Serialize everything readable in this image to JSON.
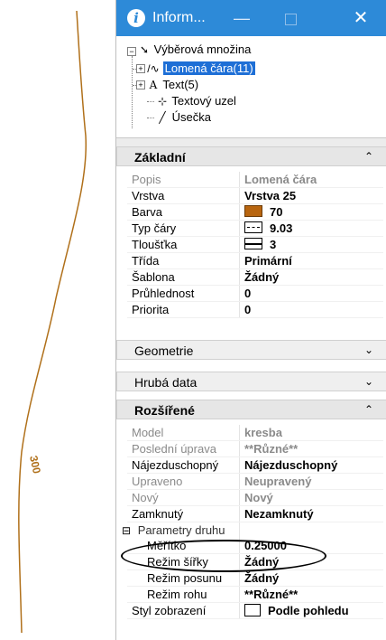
{
  "drawing": {
    "annotation_label": "300",
    "line_color": "#b0701a"
  },
  "window": {
    "title": "Inform...",
    "info_icon": "i",
    "min_glyph": "—",
    "close_glyph": "✕",
    "accent_color": "#2d8ad8"
  },
  "tree": {
    "root_label": "Výběrová množina",
    "items": [
      {
        "icon": "polyline-icon",
        "glyph": "/∿",
        "label": "Lomená čára(11)",
        "selected": true
      },
      {
        "icon": "text-icon",
        "glyph": "A",
        "label": "Text(5)",
        "selected": false
      },
      {
        "icon": "text-node-icon",
        "glyph": "⊹",
        "label": "Textový uzel",
        "selected": false
      },
      {
        "icon": "line-icon",
        "glyph": "╱",
        "label": "Úsečka",
        "selected": false
      }
    ]
  },
  "sections": {
    "basic": {
      "title": "Základní",
      "chevron": "⌃"
    },
    "geometry": {
      "title": "Geometrie",
      "chevron": "⌄"
    },
    "raw": {
      "title": "Hrubá data",
      "chevron": "⌄"
    },
    "extended": {
      "title": "Rozšířené",
      "chevron": "⌃"
    }
  },
  "basic_props": [
    {
      "name": "Popis",
      "value": "Lomená čára",
      "muted": true
    },
    {
      "name": "Vrstva",
      "value": "Vrstva 25"
    },
    {
      "name": "Barva",
      "value": "70",
      "swatch": "#b8650f"
    },
    {
      "name": "Typ čáry",
      "value": "9.03"
    },
    {
      "name": "Tloušťka",
      "value": "3"
    },
    {
      "name": "Třída",
      "value": "Primární"
    },
    {
      "name": "Šablona",
      "value": "Žádný"
    },
    {
      "name": "Průhlednost",
      "value": "0"
    },
    {
      "name": "Priorita",
      "value": "0"
    }
  ],
  "extended_props": [
    {
      "name": "Model",
      "value": "kresba",
      "muted": true
    },
    {
      "name": "Poslední úprava",
      "value": "**Různé**",
      "muted": true
    },
    {
      "name": "Nájezduschopný",
      "value": "Nájezduschopný"
    },
    {
      "name": "Upraveno",
      "value": "Neupravený",
      "muted": true
    },
    {
      "name": "Nový",
      "value": "Nový",
      "muted": true
    },
    {
      "name": "Zamknutý",
      "value": "Nezamknutý"
    }
  ],
  "group": {
    "toggle": "⊟",
    "label": "Parametry druhu"
  },
  "group_props": [
    {
      "name": "Měřítko",
      "value": "0.25000"
    },
    {
      "name": "Režim šířky",
      "value": "Žádný"
    },
    {
      "name": "Režim posunu",
      "value": "Žádný"
    },
    {
      "name": "Režim rohu",
      "value": "**Různé**"
    }
  ],
  "display_style": {
    "name": "Styl zobrazení",
    "value": "Podle pohledu"
  }
}
